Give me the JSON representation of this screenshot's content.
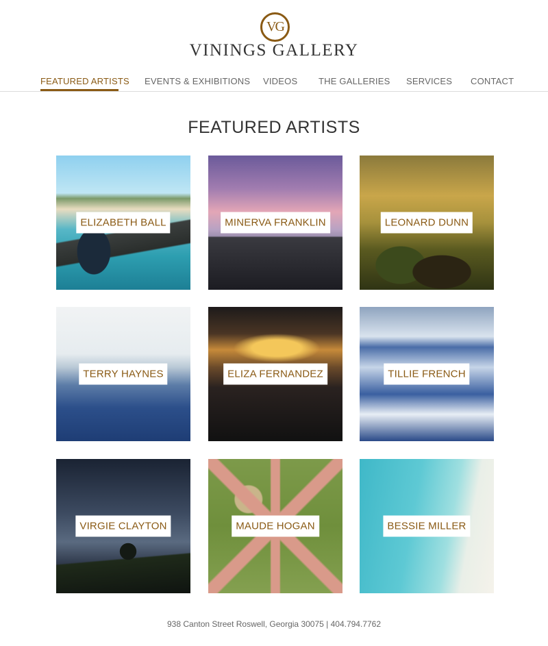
{
  "brand": {
    "monogram": "VG",
    "name": "VININGS GALLERY"
  },
  "nav": {
    "items": [
      {
        "label": "FEATURED ARTISTS",
        "active": true
      },
      {
        "label": "EVENTS & EXHIBITIONS",
        "active": false
      },
      {
        "label": "VIDEOS",
        "active": false
      },
      {
        "label": "THE GALLERIES",
        "active": false
      },
      {
        "label": "SERVICES",
        "active": false
      },
      {
        "label": "CONTACT",
        "active": false
      }
    ]
  },
  "main": {
    "title": "FEATURED ARTISTS",
    "artists": [
      {
        "name": "ELIZABETH BALL"
      },
      {
        "name": "MINERVA FRANKLIN"
      },
      {
        "name": "LEONARD DUNN"
      },
      {
        "name": "TERRY HAYNES"
      },
      {
        "name": "ELIZA FERNANDEZ"
      },
      {
        "name": "TILLIE FRENCH"
      },
      {
        "name": "VIRGIE CLAYTON"
      },
      {
        "name": "MAUDE HOGAN"
      },
      {
        "name": "BESSIE MILLER"
      }
    ]
  },
  "footer": {
    "address": "938 Canton Street Roswell, Georgia 30075 | 404.794.7762"
  },
  "colors": {
    "accent": "#8a5a14",
    "nav_text": "#666666",
    "divider": "#dcdcdc"
  }
}
